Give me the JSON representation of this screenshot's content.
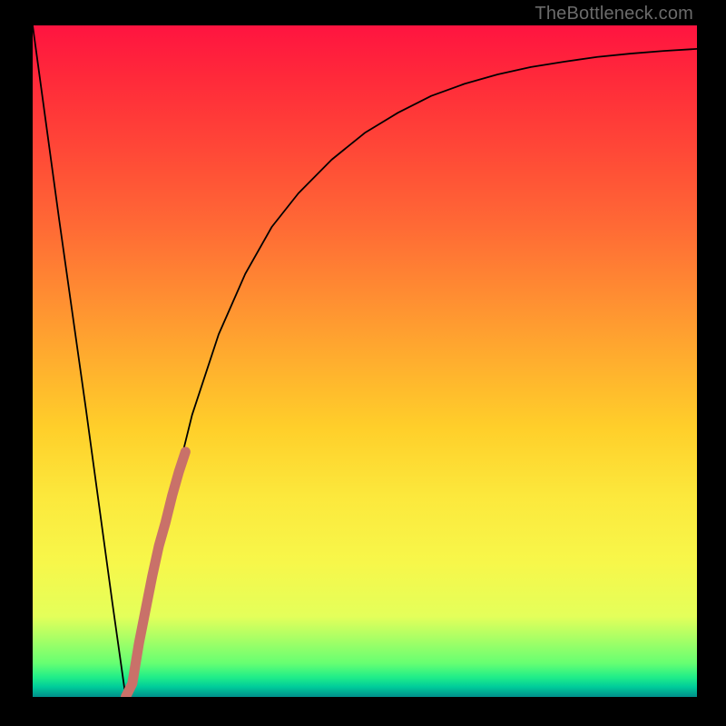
{
  "watermark": "TheBottleneck.com",
  "colors": {
    "bg": "#000000",
    "curve": "#000000",
    "highlight": "#c97169"
  },
  "chart_data": {
    "type": "line",
    "title": "",
    "xlabel": "",
    "ylabel": "",
    "xlim": [
      0,
      100
    ],
    "ylim": [
      0,
      100
    ],
    "grid": false,
    "series": [
      {
        "name": "bottleneck-curve",
        "x": [
          0,
          4,
          8,
          12,
          14,
          16,
          20,
          24,
          28,
          32,
          36,
          40,
          45,
          50,
          55,
          60,
          65,
          70,
          75,
          80,
          85,
          90,
          95,
          100
        ],
        "values": [
          100,
          71,
          43,
          14,
          0,
          8,
          26,
          42,
          54,
          63,
          70,
          75,
          80,
          84,
          87,
          89.5,
          91.3,
          92.7,
          93.8,
          94.6,
          95.3,
          95.8,
          96.2,
          96.5
        ]
      },
      {
        "name": "highlight-segment",
        "x": [
          14,
          15,
          16,
          17,
          18,
          19,
          20,
          21,
          22,
          23
        ],
        "values": [
          0,
          2,
          8,
          13,
          18,
          22.5,
          26,
          30,
          33.5,
          36.5
        ]
      }
    ]
  }
}
